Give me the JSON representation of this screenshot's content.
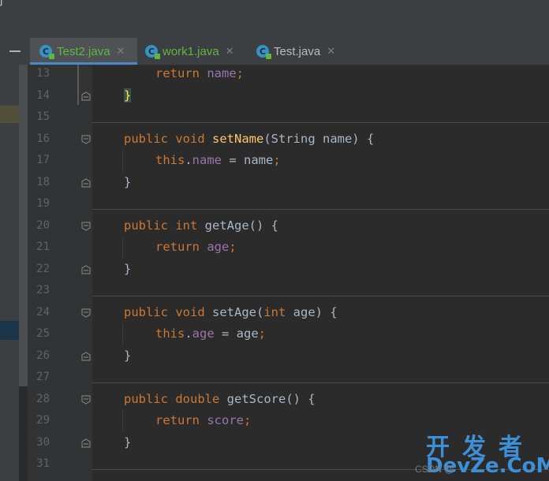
{
  "tabs": [
    {
      "label": "Test2.java",
      "icon": "java-class-icon",
      "active": true
    },
    {
      "label": "work1.java",
      "icon": "java-class-icon",
      "active": false
    },
    {
      "label": "Test.java",
      "icon": "java-class-icon",
      "active": false
    }
  ],
  "close_glyph": "✕",
  "lines": [
    {
      "n": "13",
      "code": [
        [
          "kw",
          "return "
        ],
        [
          "fld",
          "name"
        ],
        [
          "kw",
          ";"
        ]
      ],
      "indent": 2
    },
    {
      "n": "14",
      "code": [
        [
          "brace",
          "}"
        ]
      ],
      "indent": 1
    },
    {
      "n": "15",
      "code": [],
      "indent": 0
    },
    {
      "n": "16",
      "code": [
        [
          "kw",
          "public "
        ],
        [
          "kw",
          "void "
        ],
        [
          "fn",
          "setName"
        ],
        [
          "p",
          "(String name) {"
        ]
      ],
      "indent": 1
    },
    {
      "n": "17",
      "code": [
        [
          "kw",
          "this"
        ],
        [
          "p",
          "."
        ],
        [
          "fld",
          "name"
        ],
        [
          "p",
          " = name"
        ],
        [
          "kw",
          ";"
        ]
      ],
      "indent": 2
    },
    {
      "n": "18",
      "code": [
        [
          "p",
          "}"
        ]
      ],
      "indent": 1
    },
    {
      "n": "19",
      "code": [],
      "indent": 0
    },
    {
      "n": "20",
      "code": [
        [
          "kw",
          "public "
        ],
        [
          "kw",
          "int "
        ],
        [
          "p2",
          "getAge"
        ],
        [
          "p",
          "() {"
        ]
      ],
      "indent": 1
    },
    {
      "n": "21",
      "code": [
        [
          "kw",
          "return "
        ],
        [
          "fld",
          "age"
        ],
        [
          "kw",
          ";"
        ]
      ],
      "indent": 2
    },
    {
      "n": "22",
      "code": [
        [
          "p",
          "}"
        ]
      ],
      "indent": 1
    },
    {
      "n": "23",
      "code": [],
      "indent": 0
    },
    {
      "n": "24",
      "code": [
        [
          "kw",
          "public "
        ],
        [
          "kw",
          "void "
        ],
        [
          "p2",
          "setAge"
        ],
        [
          "p",
          "("
        ],
        [
          "kw",
          "int "
        ],
        [
          "p",
          "age) {"
        ]
      ],
      "indent": 1
    },
    {
      "n": "25",
      "code": [
        [
          "kw",
          "this"
        ],
        [
          "p",
          "."
        ],
        [
          "fld",
          "age"
        ],
        [
          "p",
          " = age"
        ],
        [
          "kw",
          ";"
        ]
      ],
      "indent": 2
    },
    {
      "n": "26",
      "code": [
        [
          "p",
          "}"
        ]
      ],
      "indent": 1
    },
    {
      "n": "27",
      "code": [],
      "indent": 0
    },
    {
      "n": "28",
      "code": [
        [
          "kw",
          "public "
        ],
        [
          "kw",
          "double "
        ],
        [
          "p2",
          "getScore"
        ],
        [
          "p",
          "() {"
        ]
      ],
      "indent": 1
    },
    {
      "n": "29",
      "code": [
        [
          "kw",
          "return "
        ],
        [
          "fld",
          "score"
        ],
        [
          "kw",
          ";"
        ]
      ],
      "indent": 2
    },
    {
      "n": "30",
      "code": [
        [
          "p",
          "}"
        ]
      ],
      "indent": 1
    },
    {
      "n": "31",
      "code": [],
      "indent": 0
    }
  ],
  "watermark": {
    "cn": "开发者",
    "en": "DevZe.CoM",
    "csdn": "CSDN @"
  }
}
